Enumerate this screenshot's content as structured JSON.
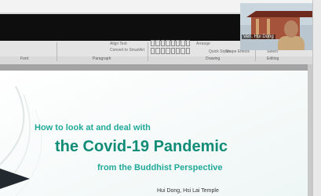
{
  "ribbon": {
    "groups": [
      "Font",
      "Paragraph",
      "Drawing",
      "Editing"
    ],
    "paragraph_items": [
      "Align Text",
      "Convert to SmartArt"
    ],
    "drawing_items": [
      "Arrange",
      "Quick Styles",
      "Shape Effects"
    ],
    "editing_items": [
      "Select"
    ]
  },
  "webcam": {
    "name": "Ven. Hui Dong"
  },
  "slide": {
    "title_line1": "How to look at and deal with",
    "title_line2": "the Covid-19 Pandemic",
    "title_line3": "from the Buddhist Perspective",
    "author": "Hui Dong, Hsi Lai Temple"
  },
  "colors": {
    "teal": "#21a999",
    "dark_green": "#118c77"
  }
}
